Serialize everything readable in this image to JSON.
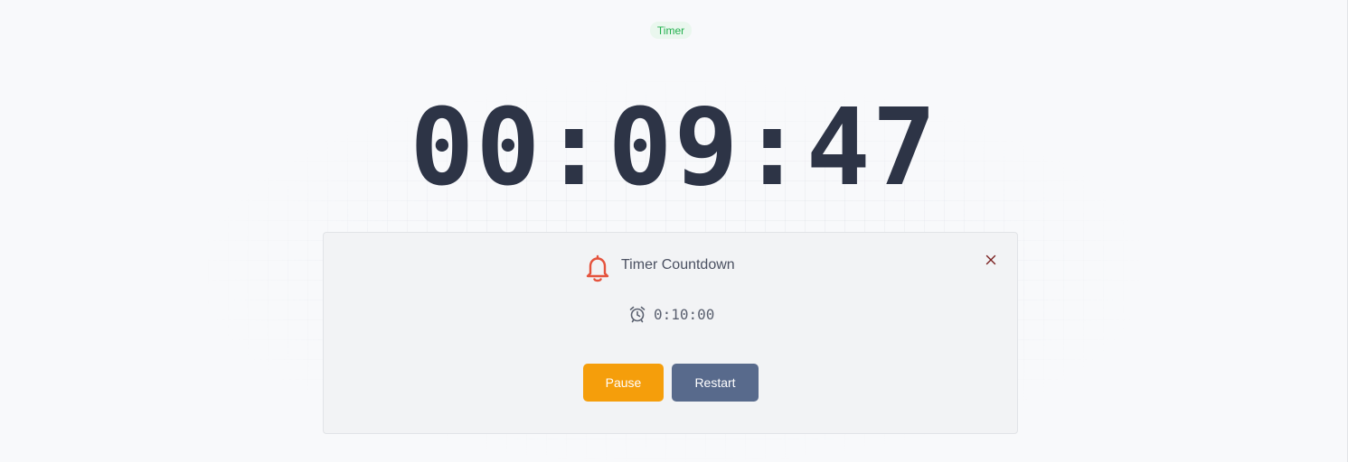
{
  "mode_badge": "Timer",
  "timer": {
    "remaining": "00:09:47"
  },
  "card": {
    "title": "Timer Countdown",
    "set_time": "0:10:00",
    "pause_label": "Pause",
    "restart_label": "Restart"
  },
  "colors": {
    "background": "#f8f9fb",
    "card_background": "#f2f3f5",
    "time_text": "#2d3446",
    "badge_text": "#23b04e",
    "badge_background": "#eaf7ee",
    "bell_icon": "#e5533d",
    "close_icon": "#7a2020",
    "pause_button": "#f59e0b",
    "restart_button": "#586a8c"
  },
  "icons": {
    "title": "bell-icon",
    "set_time": "alarm-clock-icon",
    "close": "close-icon"
  }
}
